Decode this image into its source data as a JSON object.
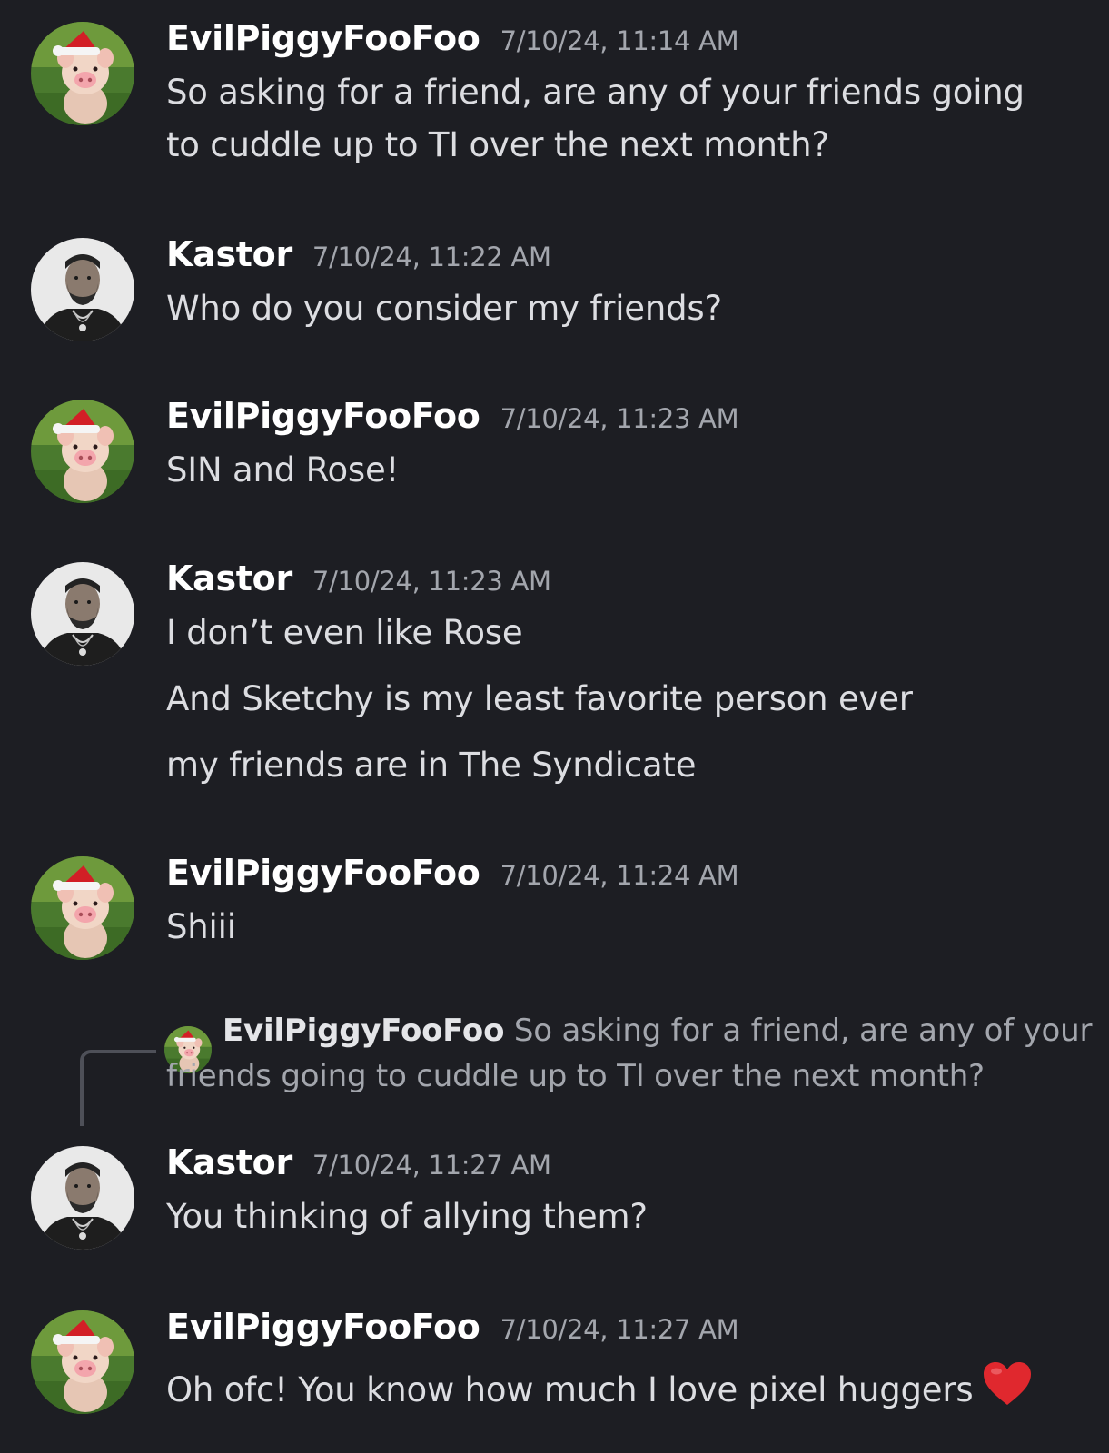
{
  "messages": [
    {
      "username": "EvilPiggyFooFoo",
      "timestamp": "7/10/24, 11:14 AM",
      "lines": [
        "So asking for a friend, are any of your friends going",
        "to cuddle up to TI over the next month?"
      ]
    },
    {
      "username": "Kastor",
      "timestamp": "7/10/24, 11:22 AM",
      "lines": [
        "Who do you consider my friends?"
      ]
    },
    {
      "username": "EvilPiggyFooFoo",
      "timestamp": "7/10/24, 11:23 AM",
      "lines": [
        "SIN and Rose!"
      ]
    },
    {
      "username": "Kastor",
      "timestamp": "7/10/24, 11:23 AM",
      "lines": [
        "I don’t even like Rose",
        "And Sketchy is my least favorite person ever",
        "my friends are in The Syndicate"
      ]
    },
    {
      "username": "EvilPiggyFooFoo",
      "timestamp": "7/10/24, 11:24 AM",
      "lines": [
        "Shiii"
      ]
    },
    {
      "username": "Kastor",
      "timestamp": "7/10/24, 11:27 AM",
      "lines": [
        "You thinking of allying them?"
      ],
      "reply": {
        "username": "EvilPiggyFooFoo",
        "text_line1": "So asking for a friend, are any of your",
        "text_line2": "friends going to cuddle up to TI over the next month?"
      }
    },
    {
      "username": "EvilPiggyFooFoo",
      "timestamp": "7/10/24, 11:27 AM",
      "lines": [
        "Oh ofc! You know how much I love pixel huggers"
      ],
      "emoji": "red-heart"
    }
  ],
  "avatars": {
    "EvilPiggyFooFoo": "piglet-santa-hat-avatar",
    "Kastor": "bearded-man-avatar"
  },
  "colors": {
    "background": "#1d1e23",
    "username": "#ffffff",
    "text": "#dcdde1",
    "timestamp": "#a3a6ad",
    "heart": "#e0282e"
  }
}
